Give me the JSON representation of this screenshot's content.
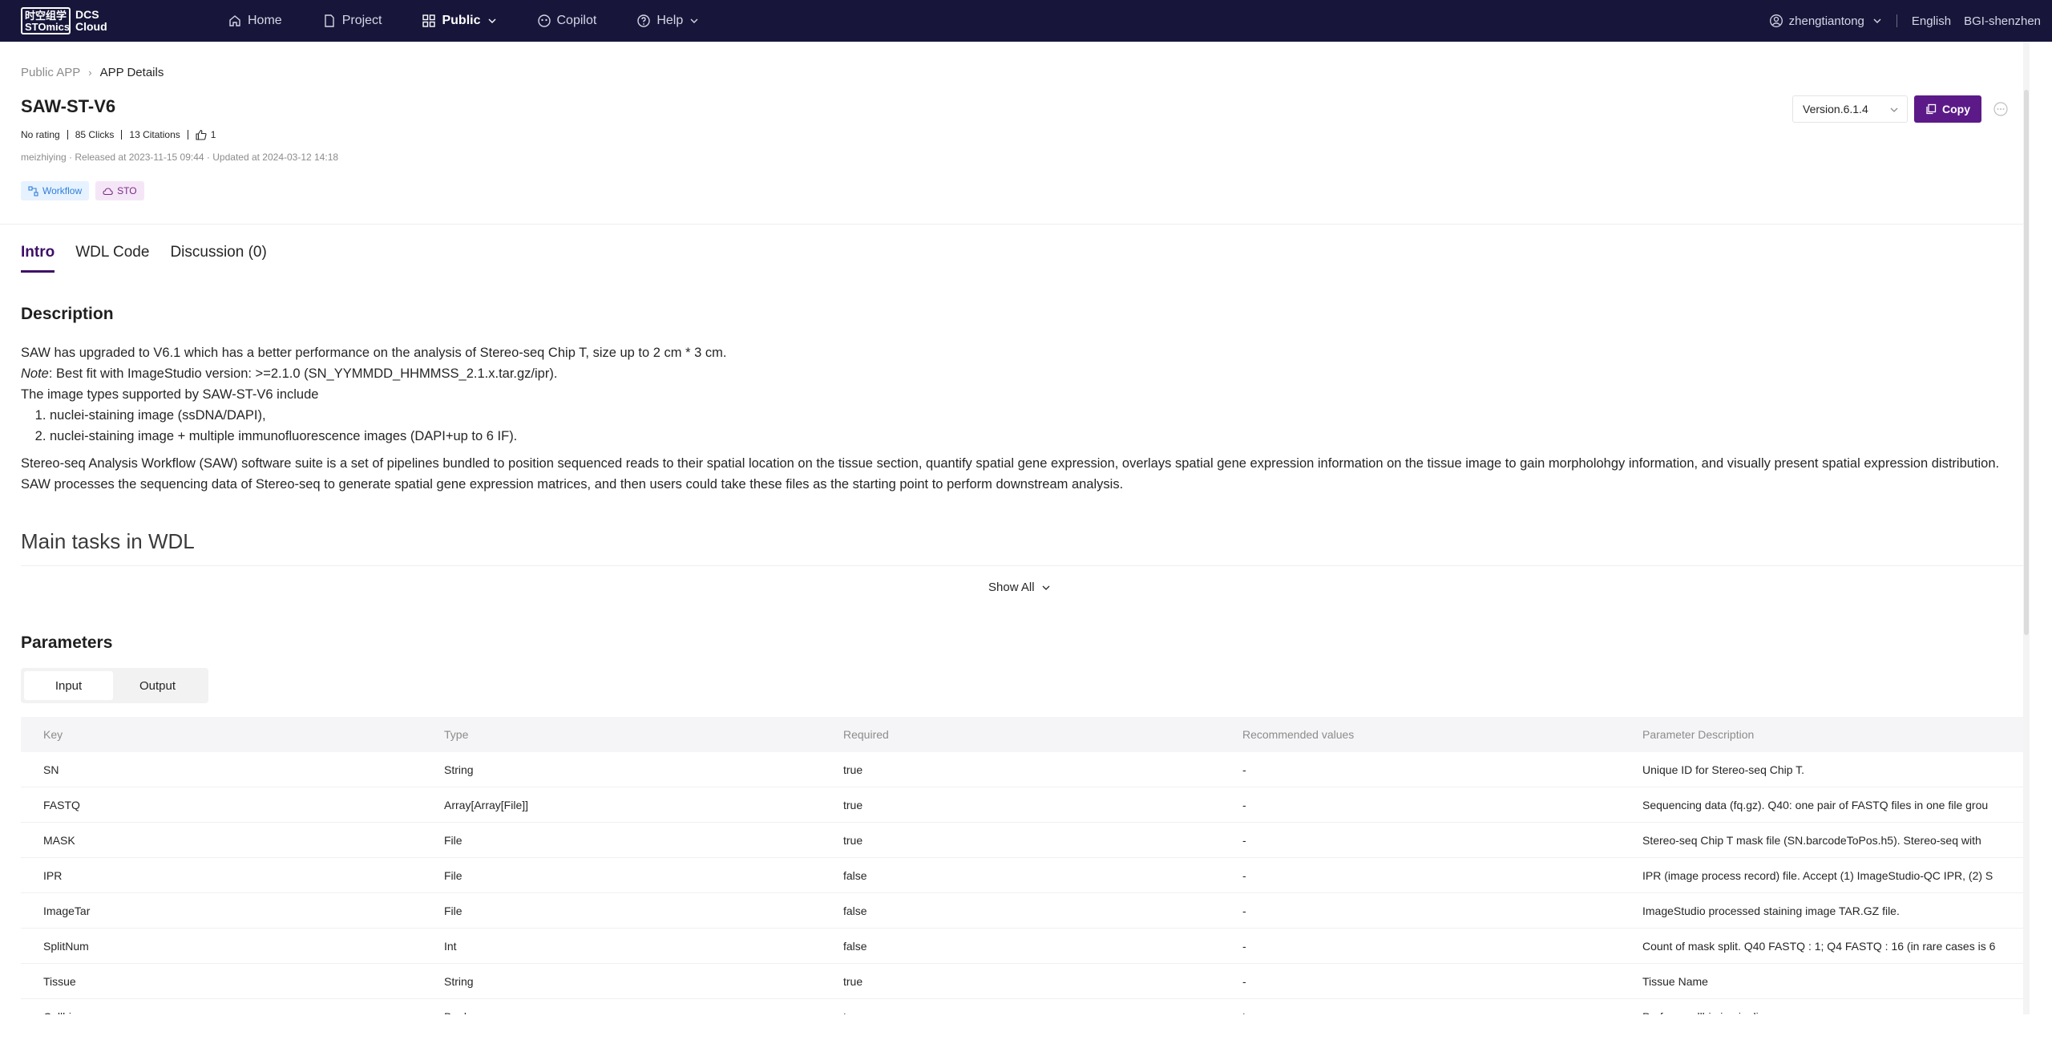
{
  "topbar": {
    "logo_box": "时空组学 STOmics",
    "logo_text_line1": "DCS",
    "logo_text_line2": "Cloud",
    "nav": [
      {
        "label": "Home",
        "icon": "home-icon"
      },
      {
        "label": "Project",
        "icon": "file-icon"
      },
      {
        "label": "Public",
        "icon": "grid-icon",
        "active": true,
        "dropdown": true
      },
      {
        "label": "Copilot",
        "icon": "copilot-icon"
      },
      {
        "label": "Help",
        "icon": "help-icon",
        "dropdown": true
      }
    ],
    "user": "zhengtiantong",
    "language": "English",
    "region": "BGI-shenzhen"
  },
  "breadcrumb": {
    "prev": "Public APP",
    "current": "APP Details"
  },
  "app": {
    "title": "SAW-ST-V6",
    "rating": "No rating",
    "clicks": "85 Clicks",
    "citations": "13 Citations",
    "likes": "1",
    "meta": "meizhiying · Released at 2023-11-15 09:44 · Updated at 2024-03-12 14:18",
    "tags": [
      "Workflow",
      "STO"
    ],
    "version": "Version.6.1.4",
    "copy_label": "Copy"
  },
  "tabs": [
    "Intro",
    "WDL Code",
    "Discussion (0)"
  ],
  "description": {
    "heading": "Description",
    "line1": "SAW has upgraded to V6.1 which has a better performance on the analysis of Stereo-seq Chip T, size up to 2 cm * 3 cm.",
    "note_label": "Note",
    "note_text": ": Best fit with ImageStudio version: >=2.1.0 (SN_YYMMDD_HHMMSS_2.1.x.tar.gz/ipr).",
    "line3": "The image types supported by SAW-ST-V6 include",
    "list": [
      "nuclei-staining image (ssDNA/DAPI),",
      "nuclei-staining image + multiple immunofluorescence images (DAPI+up to 6 IF)."
    ],
    "paragraph": "Stereo-seq Analysis Workflow (SAW) software suite is a set of pipelines bundled to position sequenced reads to their spatial location on the tissue section, quantify spatial gene expression, overlays spatial gene expression information on the tissue image to gain morpholohgy information, and visually present spatial expression distribution. SAW processes the sequencing data of Stereo-seq to generate spatial gene expression matrices, and then users could take these files as the starting point to perform downstream analysis."
  },
  "main_tasks_heading": "Main tasks in WDL",
  "show_all": "Show All",
  "parameters": {
    "heading": "Parameters",
    "segments": [
      "Input",
      "Output"
    ],
    "columns": [
      "Key",
      "Type",
      "Required",
      "Recommended values",
      "Parameter Description"
    ],
    "rows": [
      [
        "SN",
        "String",
        "true",
        "-",
        "Unique ID for Stereo-seq Chip T."
      ],
      [
        "FASTQ",
        "Array[Array[File]]",
        "true",
        "-",
        "Sequencing data (fq.gz). Q40: one pair of FASTQ files in one file grou"
      ],
      [
        "MASK",
        "File",
        "true",
        "-",
        "Stereo-seq Chip T mask file (SN.barcodeToPos.h5). Stereo-seq with"
      ],
      [
        "IPR",
        "File",
        "false",
        "-",
        "IPR (image process record) file. Accept (1) ImageStudio-QC IPR, (2) S"
      ],
      [
        "ImageTar",
        "File",
        "false",
        "-",
        "ImageStudio processed staining image TAR.GZ file."
      ],
      [
        "SplitNum",
        "Int",
        "false",
        "-",
        "Count of mask split. Q40 FASTQ : 1; Q4 FASTQ : 16 (in rare cases is 6"
      ],
      [
        "Tissue",
        "String",
        "true",
        "-",
        "Tissue Name"
      ],
      [
        "Cellbin",
        "Boolean",
        "true",
        "true",
        "Perform cellbin in pipeline"
      ]
    ]
  },
  "colors": {
    "topbar": "#17163a",
    "accent": "#5c1a88",
    "tab_active": "#3e1066"
  }
}
